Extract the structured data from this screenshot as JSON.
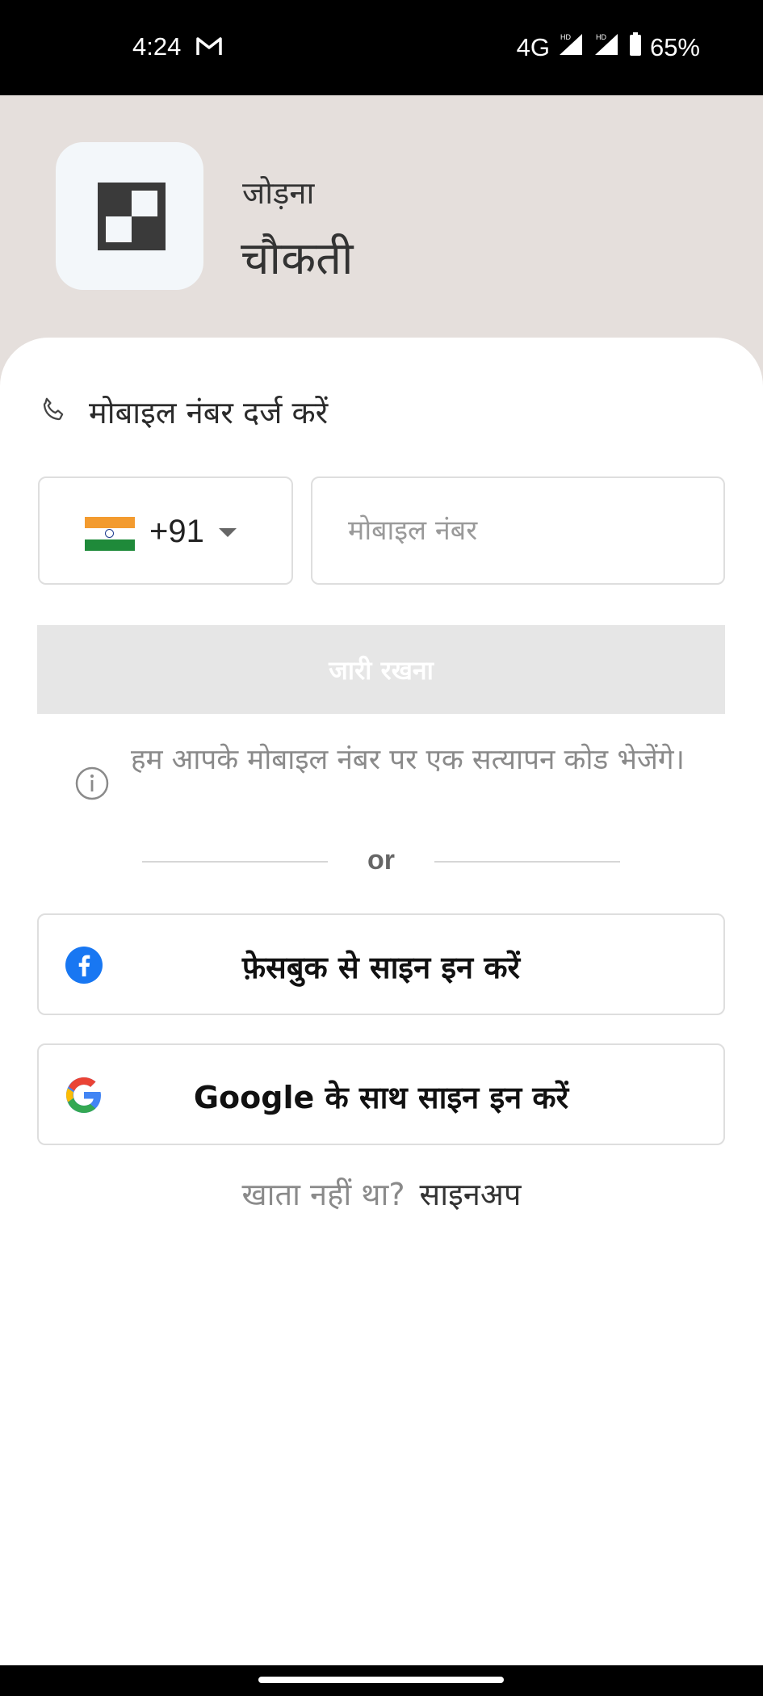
{
  "status_bar": {
    "time": "4:24",
    "network": "4G",
    "battery": "65%",
    "icons": [
      "gmail-icon",
      "signal-hd-icon",
      "signal-hd-icon",
      "battery-icon"
    ]
  },
  "app": {
    "subtitle": "जोड़ना",
    "title": "चौकती"
  },
  "form": {
    "section_label": "मोबाइल नंबर दर्ज करें",
    "country_code": "+91",
    "country_flag": "india-flag-icon",
    "phone_placeholder": "मोबाइल नंबर",
    "phone_value": "",
    "continue_label": "जारी रखना",
    "info_text": "हम आपके मोबाइल नंबर पर एक सत्यापन कोड भेजेंगे।",
    "divider_text": "or"
  },
  "social": {
    "facebook_label": "फ़ेसबुक से साइन इन करें",
    "google_label": "Google के साथ साइन इन करें"
  },
  "signup": {
    "question": "खाता नहीं था?",
    "link": "साइनअप"
  },
  "colors": {
    "header_bg": "#e5dfdc",
    "facebook_blue": "#1877f2",
    "continue_disabled": "#e6e6e6"
  }
}
